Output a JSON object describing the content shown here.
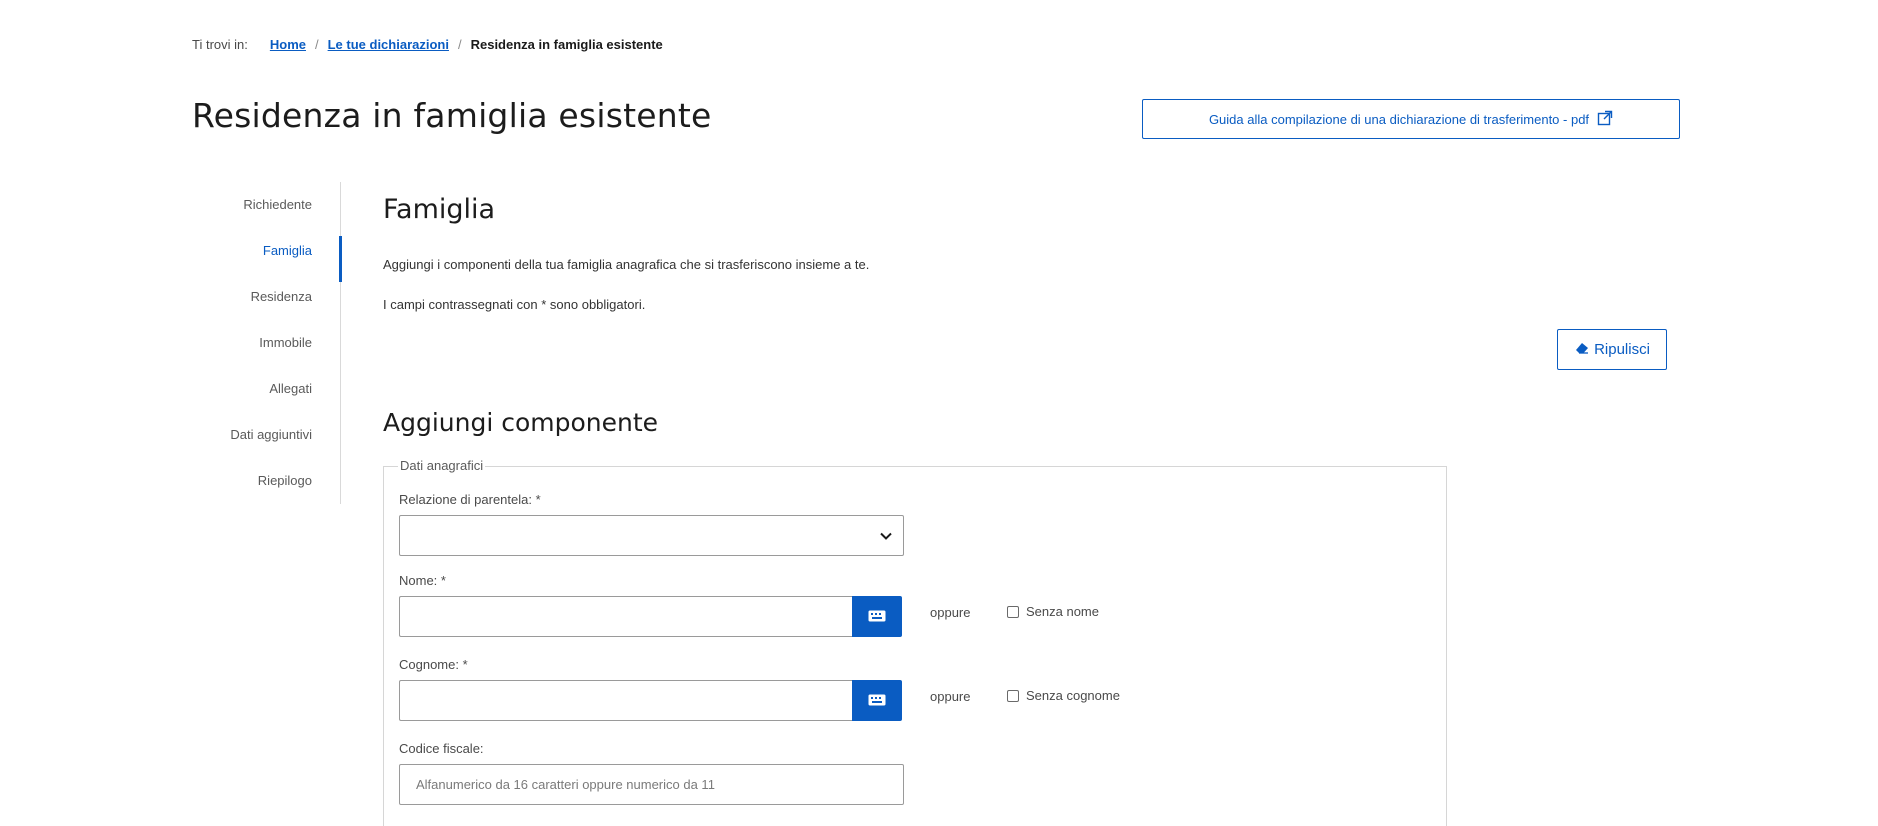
{
  "breadcrumb": {
    "prefix": "Ti trovi in:",
    "items": [
      "Home",
      "Le tue dichiarazioni"
    ],
    "current": "Residenza in famiglia esistente"
  },
  "page_title": "Residenza in famiglia esistente",
  "guide_button_label": "Guida alla compilazione di una dichiarazione di trasferimento - pdf",
  "side_nav": {
    "items": [
      "Richiedente",
      "Famiglia",
      "Residenza",
      "Immobile",
      "Allegati",
      "Dati aggiuntivi",
      "Riepilogo"
    ],
    "active": "Famiglia"
  },
  "section": {
    "title": "Famiglia",
    "description": "Aggiungi i componenti della tua famiglia anagrafica che si trasferiscono insieme a te.",
    "required_note": "I campi contrassegnati con * sono obbligatori."
  },
  "reset_button_label": "Ripulisci",
  "subsection_title": "Aggiungi componente",
  "form": {
    "legend": "Dati anagrafici",
    "relation_label": "Relazione di parentela: *",
    "relation_value": "",
    "name_label": "Nome: *",
    "name_value": "",
    "surname_label": "Cognome: *",
    "surname_value": "",
    "or_text": "oppure",
    "no_name_label": "Senza nome",
    "no_surname_label": "Senza cognome",
    "cf_label": "Codice fiscale:",
    "cf_placeholder": "Alfanumerico da 16 caratteri oppure numerico da 11"
  },
  "colors": {
    "accent": "#0a5cc2",
    "border": "#9a9a9a",
    "text": "#1c1c1c"
  }
}
